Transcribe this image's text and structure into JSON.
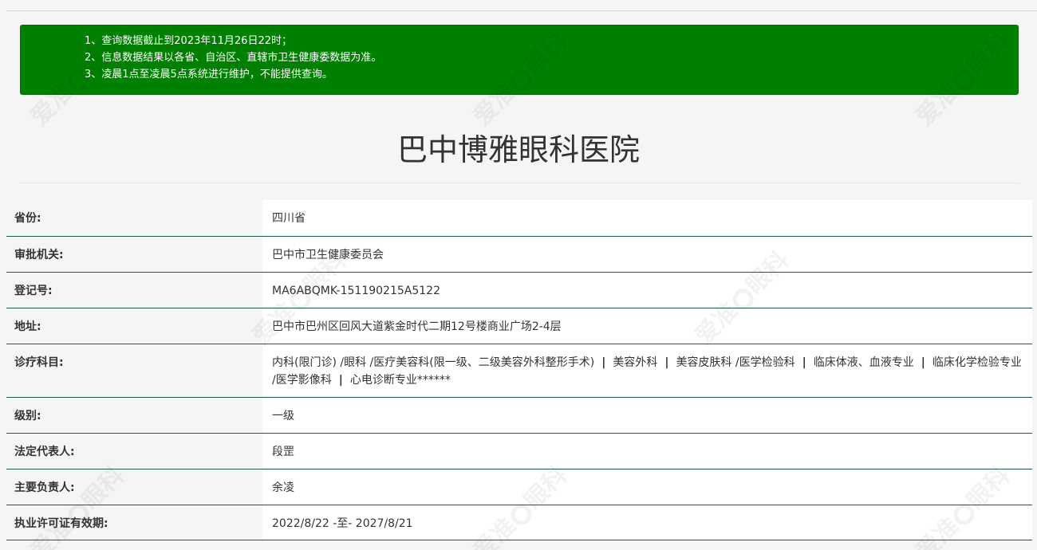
{
  "notice": {
    "items": [
      "1、查询数据截止到2023年11月26日22时；",
      "2、信息数据结果以各省、自治区、直辖市卫生健康委数据为准。",
      "3、凌晨1点至凌晨5点系统进行维护，不能提供查询。"
    ],
    "background_color": "#008000"
  },
  "hospital": {
    "name": "巴中博雅眼科医院"
  },
  "fields": {
    "province": {
      "label": "省份:",
      "value": "四川省"
    },
    "approval_authority": {
      "label": "审批机关:",
      "value": "巴中市卫生健康委员会"
    },
    "registration_no": {
      "label": "登记号:",
      "value": "MA6ABQMK-151190215A5122"
    },
    "address": {
      "label": "地址:",
      "value": "巴中市巴州区回风大道紫金时代二期12号楼商业广场2-4层"
    },
    "departments": {
      "label": "诊疗科目:",
      "parts": [
        "内科(限门诊) /眼科 /医疗美容科(限一级、二级美容外科整形手术)",
        "美容外科",
        "美容皮肤科 /医学检验科",
        "临床体液、血液专业",
        "临床化学检验专业 /医学影像科",
        "心电诊断专业******"
      ],
      "separator": "|"
    },
    "level": {
      "label": "级别:",
      "value": "一级"
    },
    "legal_representative": {
      "label": "法定代表人:",
      "value": "段罡"
    },
    "principal": {
      "label": "主要负责人:",
      "value": "余凌"
    },
    "license_validity": {
      "label": "执业许可证有效期:",
      "value": "2022/8/22 -至- 2027/8/21"
    }
  },
  "watermark": {
    "text": "爱准",
    "text2": "眼科"
  },
  "colors": {
    "row_border": "#1e5e3e",
    "label_bg": "#f5f5f5",
    "value_bg": "#ffffff"
  }
}
